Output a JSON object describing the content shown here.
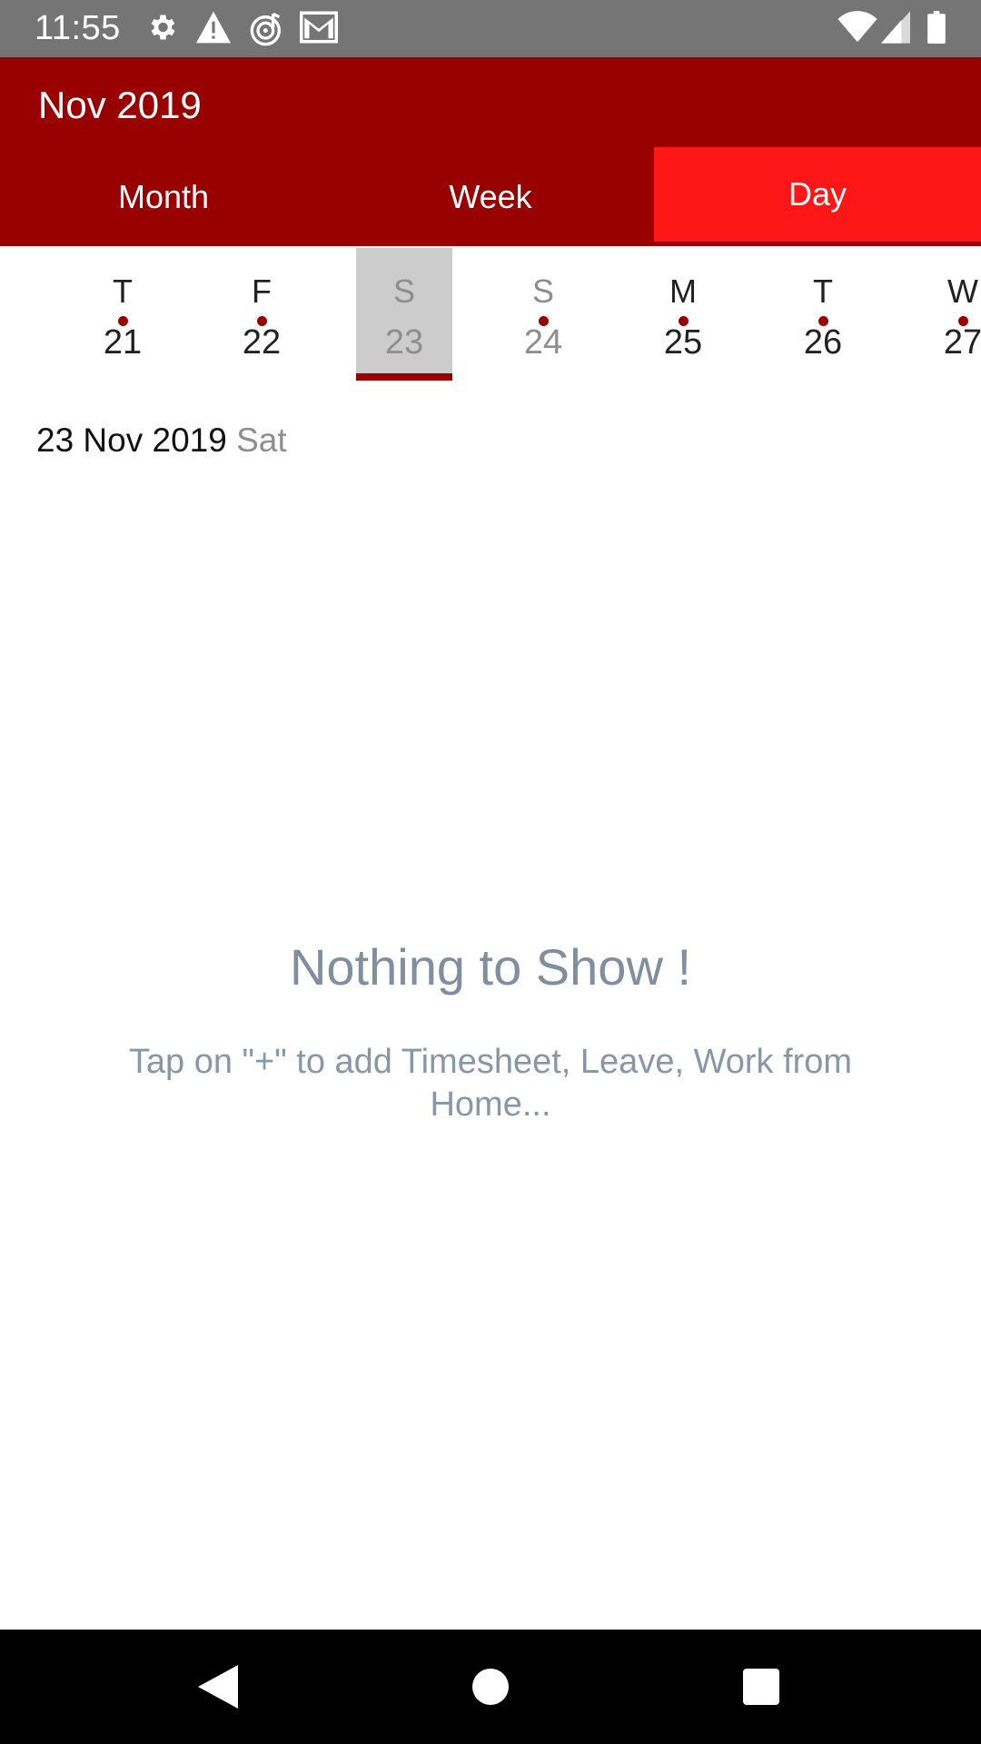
{
  "status_bar": {
    "time": "11:55",
    "icons": [
      "settings-gear-icon",
      "warning-icon",
      "music-radar-icon",
      "gmail-icon",
      "wifi-icon",
      "signal-icon",
      "battery-icon"
    ]
  },
  "header": {
    "title": "Nov 2019",
    "tabs": [
      {
        "label": "Month",
        "active": false
      },
      {
        "label": "Week",
        "active": false
      },
      {
        "label": "Day",
        "active": true
      }
    ]
  },
  "week_strip": {
    "days": [
      {
        "weekday": "T",
        "date": "21",
        "has_event": true,
        "weekend": false,
        "selected": false
      },
      {
        "weekday": "F",
        "date": "22",
        "has_event": true,
        "weekend": false,
        "selected": false
      },
      {
        "weekday": "S",
        "date": "23",
        "has_event": false,
        "weekend": true,
        "selected": true
      },
      {
        "weekday": "S",
        "date": "24",
        "has_event": true,
        "weekend": true,
        "selected": false
      },
      {
        "weekday": "M",
        "date": "25",
        "has_event": true,
        "weekend": false,
        "selected": false
      },
      {
        "weekday": "T",
        "date": "26",
        "has_event": true,
        "weekend": false,
        "selected": false
      },
      {
        "weekday": "W",
        "date": "27",
        "has_event": true,
        "weekend": false,
        "selected": false
      }
    ]
  },
  "selected_date": {
    "date": "23 Nov 2019",
    "weekday": "Sat"
  },
  "empty_state": {
    "title": "Nothing to Show !",
    "message": "Tap on \"+\" to add Timesheet, Leave, Work from Home..."
  },
  "colors": {
    "brand": "#990000",
    "active_tab": "#ff1616",
    "status_bar": "#757575",
    "muted_text": "#8e8e8e",
    "empty_text": "#7f8fa0"
  }
}
